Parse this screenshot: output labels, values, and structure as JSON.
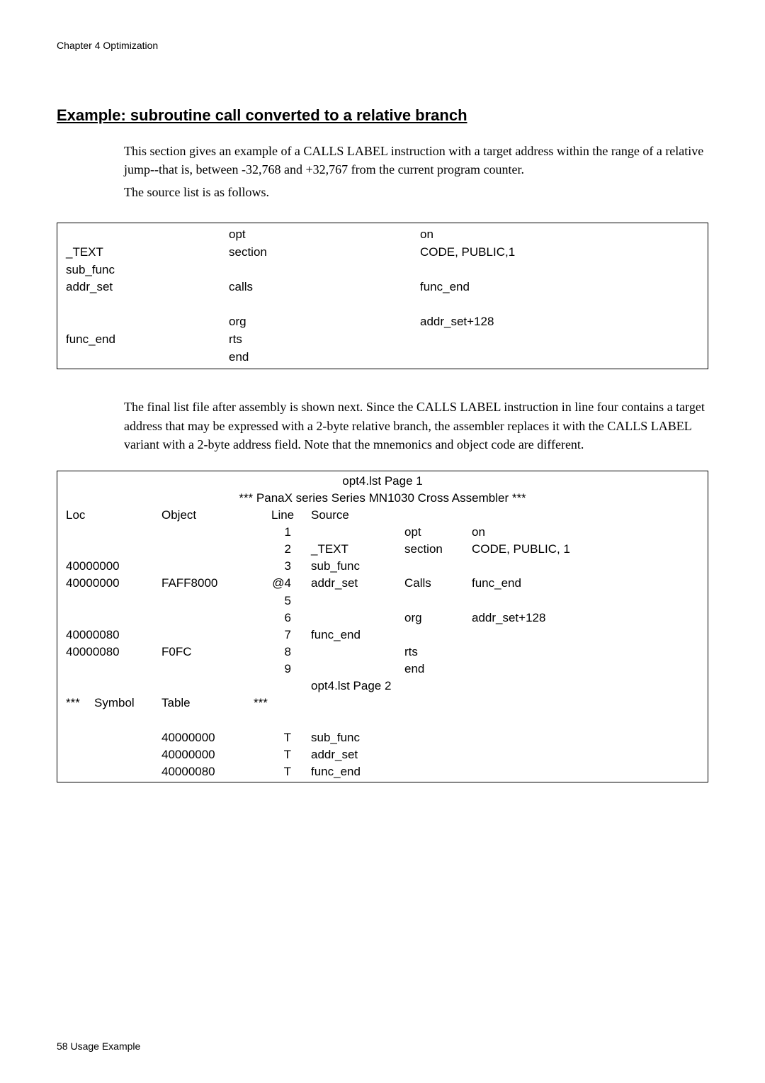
{
  "header": {
    "chapter": "Chapter 4   Optimization"
  },
  "heading": "Example: subroutine call converted to a relative branch",
  "para1": "This section gives an example of a CALLS LABEL instruction with a target address within the range of a relative jump--that is, between -32,768 and +32,767 from the current program counter.",
  "para2": "The source list is as follows.",
  "source": {
    "rows": [
      {
        "c1": "",
        "c2": "opt",
        "c3": "on"
      },
      {
        "c1": "_TEXT",
        "c2": "section",
        "c3": "CODE, PUBLIC,1"
      },
      {
        "c1": "sub_func",
        "c2": "",
        "c3": ""
      },
      {
        "c1": "addr_set",
        "c2": "calls",
        "c3": "func_end"
      },
      {
        "c1": "",
        "c2": "",
        "c3": ""
      },
      {
        "c1": "",
        "c2": "org",
        "c3": "addr_set+128"
      },
      {
        "c1": "func_end",
        "c2": "rts",
        "c3": ""
      },
      {
        "c1": "",
        "c2": "end",
        "c3": ""
      }
    ]
  },
  "para3": "The final list file after assembly is shown next. Since the CALLS LABEL instruction in line four contains a target address that may be expressed with a 2-byte relative branch, the assembler replaces it with the CALLS LABEL variant with a 2-byte address field. Note that the mnemonics and object code are different.",
  "listing": {
    "title1": "opt4.lst Page 1",
    "title2": "***  PanaX series Series MN1030 Cross Assembler  ***",
    "headers": {
      "loc": "Loc",
      "obj": "Object",
      "line": "Line",
      "src": "Source"
    },
    "rows": [
      {
        "loc": "",
        "obj": "",
        "line": "1",
        "src": "",
        "op": "opt",
        "arg": "on"
      },
      {
        "loc": "",
        "obj": "",
        "line": "2",
        "src": "_TEXT",
        "op": "section",
        "arg": "CODE, PUBLIC, 1"
      },
      {
        "loc": "40000000",
        "obj": "",
        "line": "3",
        "src": "sub_func",
        "op": "",
        "arg": ""
      },
      {
        "loc": "40000000",
        "obj": "FAFF8000",
        "line": "@4",
        "src": "addr_set",
        "op": "Calls",
        "arg": "func_end"
      },
      {
        "loc": "",
        "obj": "",
        "line": "5",
        "src": "",
        "op": "",
        "arg": ""
      },
      {
        "loc": "",
        "obj": "",
        "line": "6",
        "src": "",
        "op": "org",
        "arg": "addr_set+128"
      },
      {
        "loc": "40000080",
        "obj": "",
        "line": "7",
        "src": "func_end",
        "op": "",
        "arg": ""
      },
      {
        "loc": "40000080",
        "obj": "F0FC",
        "line": "8",
        "src": "",
        "op": "rts",
        "arg": ""
      },
      {
        "loc": "",
        "obj": "",
        "line": "9",
        "src": "",
        "op": "end",
        "arg": ""
      }
    ],
    "page2": "opt4.lst Page 2",
    "symtitle": {
      "stars_l": "***",
      "word": "Symbol",
      "table": "Table",
      "stars_r": "***"
    },
    "symrows": [
      {
        "addr": "40000000",
        "t": "T",
        "name": "sub_func"
      },
      {
        "addr": "40000000",
        "t": "T",
        "name": "addr_set"
      },
      {
        "addr": "40000080",
        "t": "T",
        "name": "func_end"
      }
    ]
  },
  "footer": "58  Usage Example"
}
